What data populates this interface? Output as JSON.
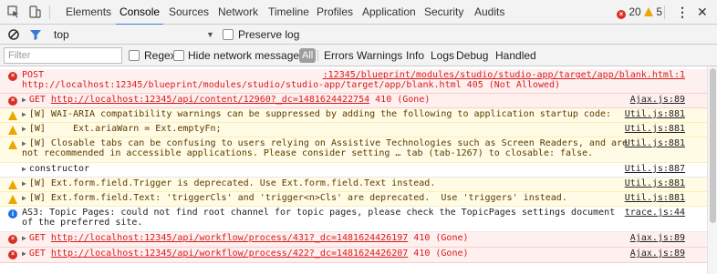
{
  "toolbar": {
    "tabs": [
      "Elements",
      "Console",
      "Sources",
      "Network",
      "Timeline",
      "Profiles",
      "Application",
      "Security",
      "Audits"
    ],
    "active_tab": "Console",
    "error_count": "20",
    "warning_count": "5",
    "menu_icon": "⋮",
    "close_icon": "✕"
  },
  "context": {
    "value": "top",
    "preserve_log_label": "Preserve log"
  },
  "filter": {
    "placeholder": "Filter",
    "regex_label": "Regex",
    "hide_network_label": "Hide network messages",
    "all_label": "All",
    "levels": [
      "Errors",
      "Warnings",
      "Info",
      "Logs",
      "Debug",
      "Handled"
    ]
  },
  "colors": {
    "error": "#d93025",
    "warning": "#e9a700",
    "info": "#1a73e8",
    "active_tab_underline": "#3879d9"
  },
  "messages": [
    {
      "level": "error",
      "prefix": "POST",
      "url": "http://localhost:12345/blueprint/modules/studio/studio-app/target/app/blank.html",
      "status": "405 (Not Allowed)",
      "source": ":12345/blueprint/modules/studio/studio-app/target/app/blank.html:1"
    },
    {
      "level": "error",
      "prefix": "GET",
      "url": "http://localhost:12345/api/content/12960?_dc=1481624422754",
      "status": "410 (Gone)",
      "source": "Ajax.js:89"
    },
    {
      "level": "warning",
      "text": "[W] WAI-ARIA compatibility warnings can be suppressed by adding the following to application startup code:",
      "source": "Util.js:881"
    },
    {
      "level": "warning",
      "text": "[W]     Ext.ariaWarn = Ext.emptyFn;",
      "source": "Util.js:881"
    },
    {
      "level": "warning",
      "text": "[W] Closable tabs can be confusing to users relying on Assistive Technologies such as Screen Readers, and are",
      "text2": "not recommended in accessible applications. Please consider setting … tab (tab-1267) to closable: false.",
      "source": "Util.js:881"
    },
    {
      "level": "plain",
      "text": "constructor",
      "source": "Util.js:887"
    },
    {
      "level": "warning",
      "text": "[W] Ext.form.field.Trigger is deprecated. Use Ext.form.field.Text instead.",
      "source": "Util.js:881"
    },
    {
      "level": "warning",
      "text": "[W] Ext.form.field.Text: 'triggerCls' and 'trigger<n>Cls' are deprecated.  Use 'triggers' instead.",
      "source": "Util.js:881"
    },
    {
      "level": "info",
      "text": "AS3: Topic Pages: could not find root channel for topic pages, please check the TopicPages settings document",
      "text2": "of the preferred site.",
      "source": "trace.js:44"
    },
    {
      "level": "error",
      "prefix": "GET",
      "url": "http://localhost:12345/api/workflow/process/431?_dc=1481624426197",
      "status": "410 (Gone)",
      "source": "Ajax.js:89"
    },
    {
      "level": "error",
      "prefix": "GET",
      "url": "http://localhost:12345/api/workflow/process/422?_dc=1481624426207",
      "status": "410 (Gone)",
      "source": "Ajax.js:89"
    }
  ]
}
